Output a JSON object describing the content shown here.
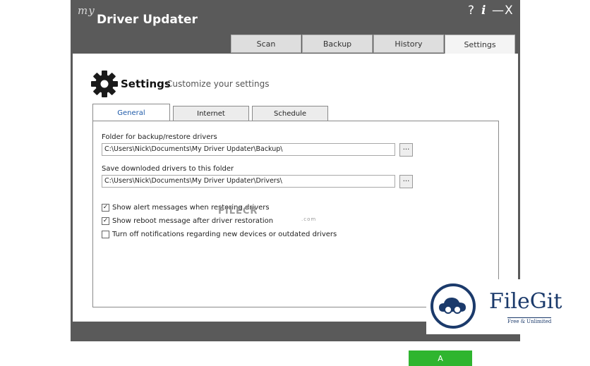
{
  "app": {
    "logo_prefix": "my",
    "logo_name": "Driver Updater"
  },
  "window_controls": [
    "?",
    "i",
    "—",
    "X"
  ],
  "main_tabs": [
    "Scan",
    "Backup",
    "History",
    "Settings"
  ],
  "page": {
    "title": "Settings",
    "subtitle": "Customize your settings"
  },
  "sub_tabs": [
    "General",
    "Internet",
    "Schedule"
  ],
  "general": {
    "backup_label": "Folder for backup/restore drivers",
    "backup_path": "C:\\Users\\Nick\\Documents\\My Driver Updater\\Backup\\",
    "download_label": "Save downloded drivers to this folder",
    "download_path": "C:\\Users\\Nick\\Documents\\My Driver Updater\\Drivers\\",
    "browse_label": "...",
    "options": [
      {
        "label": "Show alert messages when restoring drivers",
        "checked": true
      },
      {
        "label": "Show reboot message after driver restoration",
        "checked": true
      },
      {
        "label": "Turn off notifications regarding new devices or outdated drivers",
        "checked": false
      }
    ],
    "apply_label": "A"
  },
  "watermark": {
    "text": "FILECR",
    "suffix": ".com"
  },
  "filegit": {
    "name": "FileGit",
    "tagline": "Free & Unlimited"
  },
  "colors": {
    "accent_green": "#2fb52f",
    "frame": "#5a5a5a",
    "active_subtab_text": "#1e5aa8",
    "filegit_blue": "#1b3a6b"
  }
}
